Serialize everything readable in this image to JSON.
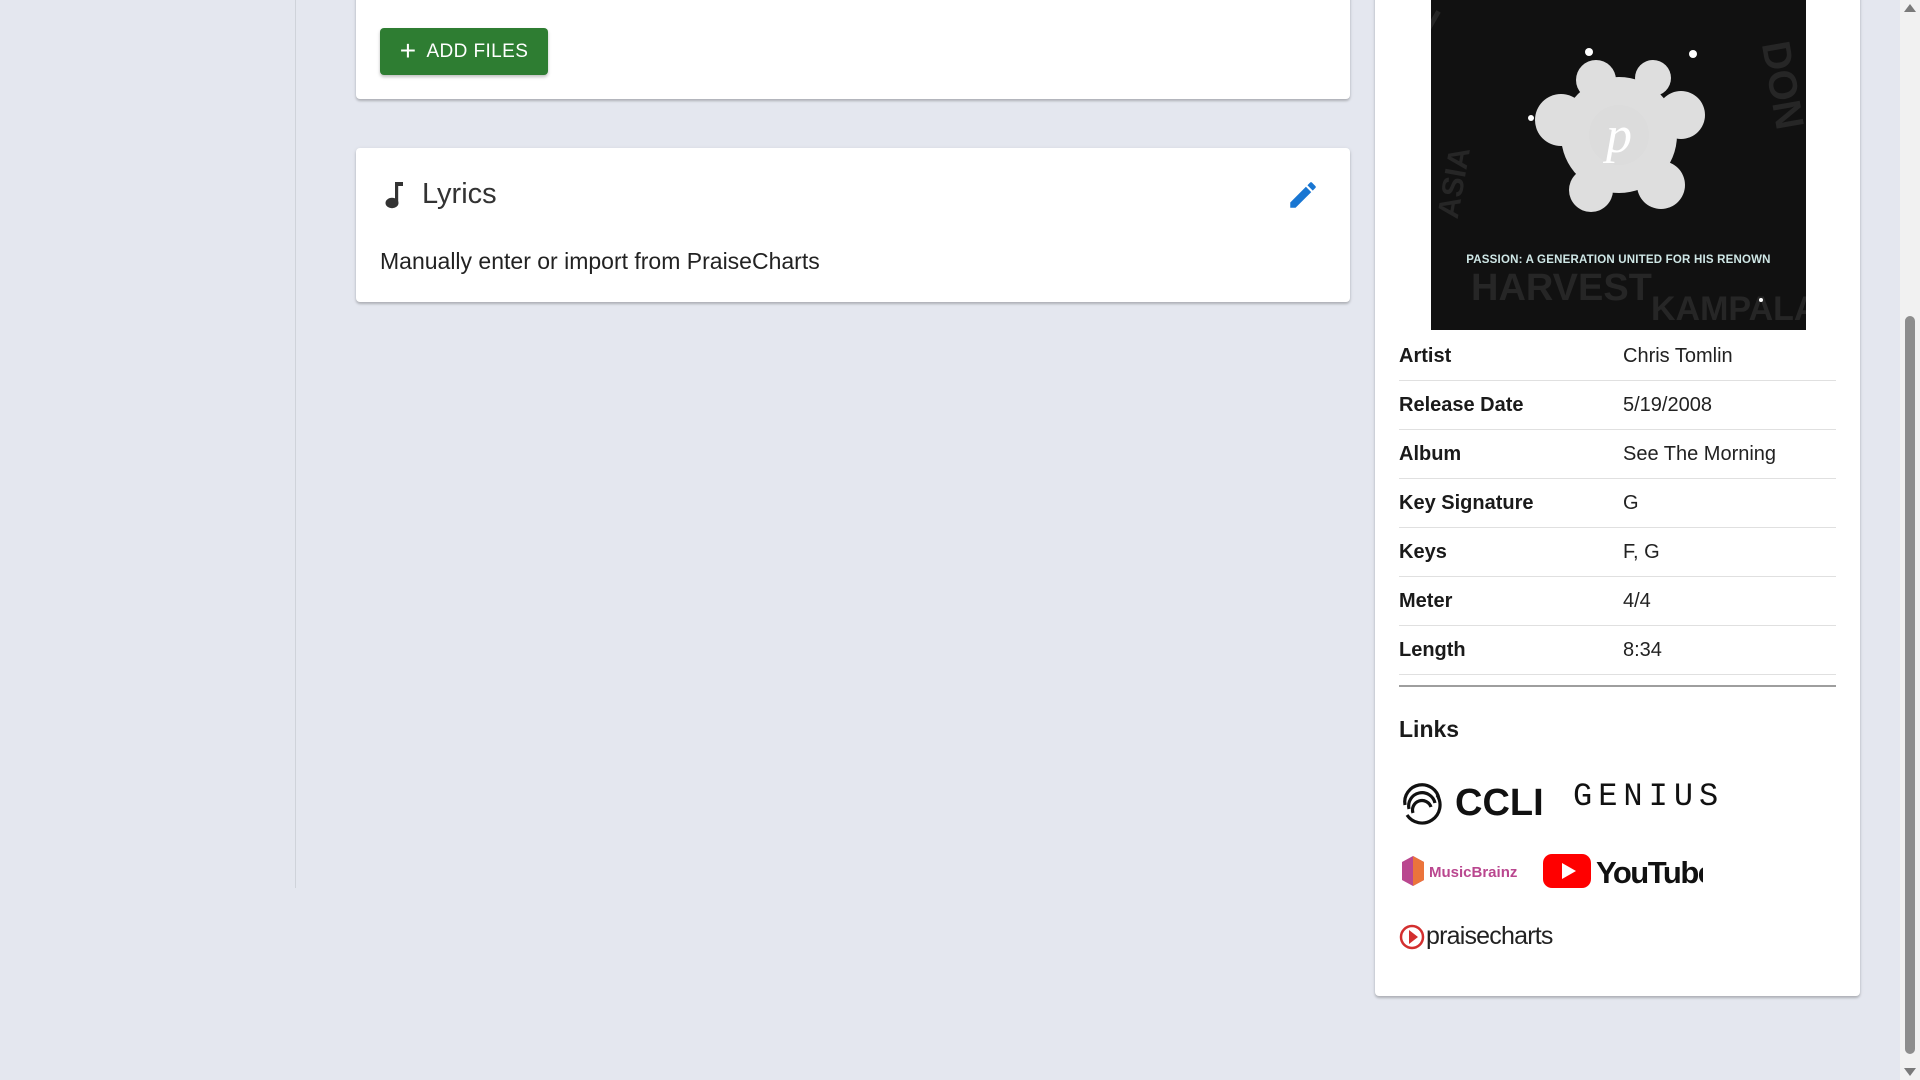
{
  "files": {
    "add_label": "ADD FILES"
  },
  "lyrics": {
    "title": "Lyrics",
    "description": "Manually enter or import from PraiseCharts"
  },
  "album_art": {
    "caption": "PASSION: A GENERATION UNITED FOR HIS RENOWN"
  },
  "song_info": {
    "rows": [
      {
        "label": "Artist",
        "value": "Chris Tomlin"
      },
      {
        "label": "Release Date",
        "value": "5/19/2008"
      },
      {
        "label": "Album",
        "value": "See The Morning"
      },
      {
        "label": "Key Signature",
        "value": "G"
      },
      {
        "label": "Keys",
        "value": "F, G"
      },
      {
        "label": "Meter",
        "value": "4/4"
      },
      {
        "label": "Length",
        "value": "8:34"
      }
    ]
  },
  "links": {
    "heading": "Links",
    "items": [
      {
        "name": "CCLI",
        "text": "CCLI"
      },
      {
        "name": "Genius",
        "text": "GENIUS"
      },
      {
        "name": "MusicBrainz",
        "text": "MusicBrainz"
      },
      {
        "name": "YouTube",
        "text": "YouTube"
      },
      {
        "name": "PraiseCharts",
        "text": "praisecharts"
      }
    ]
  },
  "colors": {
    "add_button": "#2e7d32",
    "edit_icon": "#1976d2",
    "background": "#e4e7ef",
    "youtube_red": "#ff0000",
    "praisecharts_red": "#d32f2f"
  },
  "icons": {
    "add": "plus-icon",
    "lyrics": "music-note-icon",
    "edit": "pencil-icon"
  }
}
